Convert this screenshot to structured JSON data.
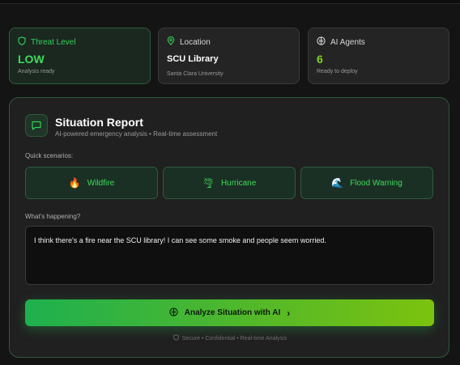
{
  "cards": {
    "threat": {
      "label": "Threat Level",
      "value": "LOW",
      "sub": "Analysis ready",
      "icon": "shield-icon"
    },
    "location": {
      "label": "Location",
      "value": "SCU Library",
      "sub": "Santa Clara University",
      "icon": "map-pin-icon"
    },
    "agents": {
      "label": "AI Agents",
      "value": "6",
      "sub": "Ready to deploy",
      "icon": "ai-brain-icon"
    }
  },
  "report": {
    "title": "Situation Report",
    "subtitle": "AI-powered emergency analysis • Real-time assessment",
    "icon": "chat-bubble-icon"
  },
  "quick": {
    "label": "Quick scenarios:",
    "items": [
      {
        "label": "Wildfire",
        "icon": "🔥"
      },
      {
        "label": "Hurricane",
        "icon": "🌪"
      },
      {
        "label": "Flood Warning",
        "icon": "🌊"
      }
    ]
  },
  "input": {
    "label": "What's happening?",
    "value": "I think there's a fire near the SCU library! I can see some smoke and people seem worried."
  },
  "analyze": {
    "label": "Analyze Situation with AI",
    "arrow": "›"
  },
  "footer": {
    "text": "Secure • Confidential • Real-time Analysis"
  },
  "colors": {
    "accent": "#3ddc5c",
    "lime": "#7ed321",
    "panel_border": "#2c5a3a"
  }
}
